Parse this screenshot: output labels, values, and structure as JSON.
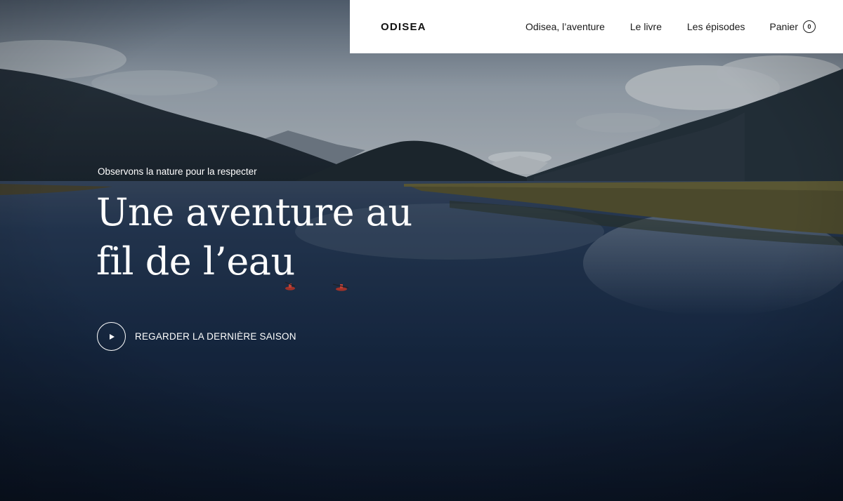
{
  "header": {
    "brand": "ODISEA",
    "nav": [
      {
        "label": "Odisea, l’aventure"
      },
      {
        "label": "Le livre"
      },
      {
        "label": "Les épisodes"
      }
    ],
    "cart": {
      "label": "Panier",
      "count": "0"
    }
  },
  "hero": {
    "eyebrow": "Observons la nature pour la respecter",
    "title_line1": "Une aventure au",
    "title_line2": "fil de l’eau",
    "cta_label": "REGARDER LA DERNIÈRE SAISON",
    "cta_icon": "play-icon"
  },
  "colors": {
    "nav_bg": "#ffffff",
    "text_dark": "#111111",
    "hero_text": "#ffffff",
    "water": "#13223b",
    "sky": "#aab5c0",
    "mountain": "#242e36",
    "reeds": "#5e5a32"
  }
}
